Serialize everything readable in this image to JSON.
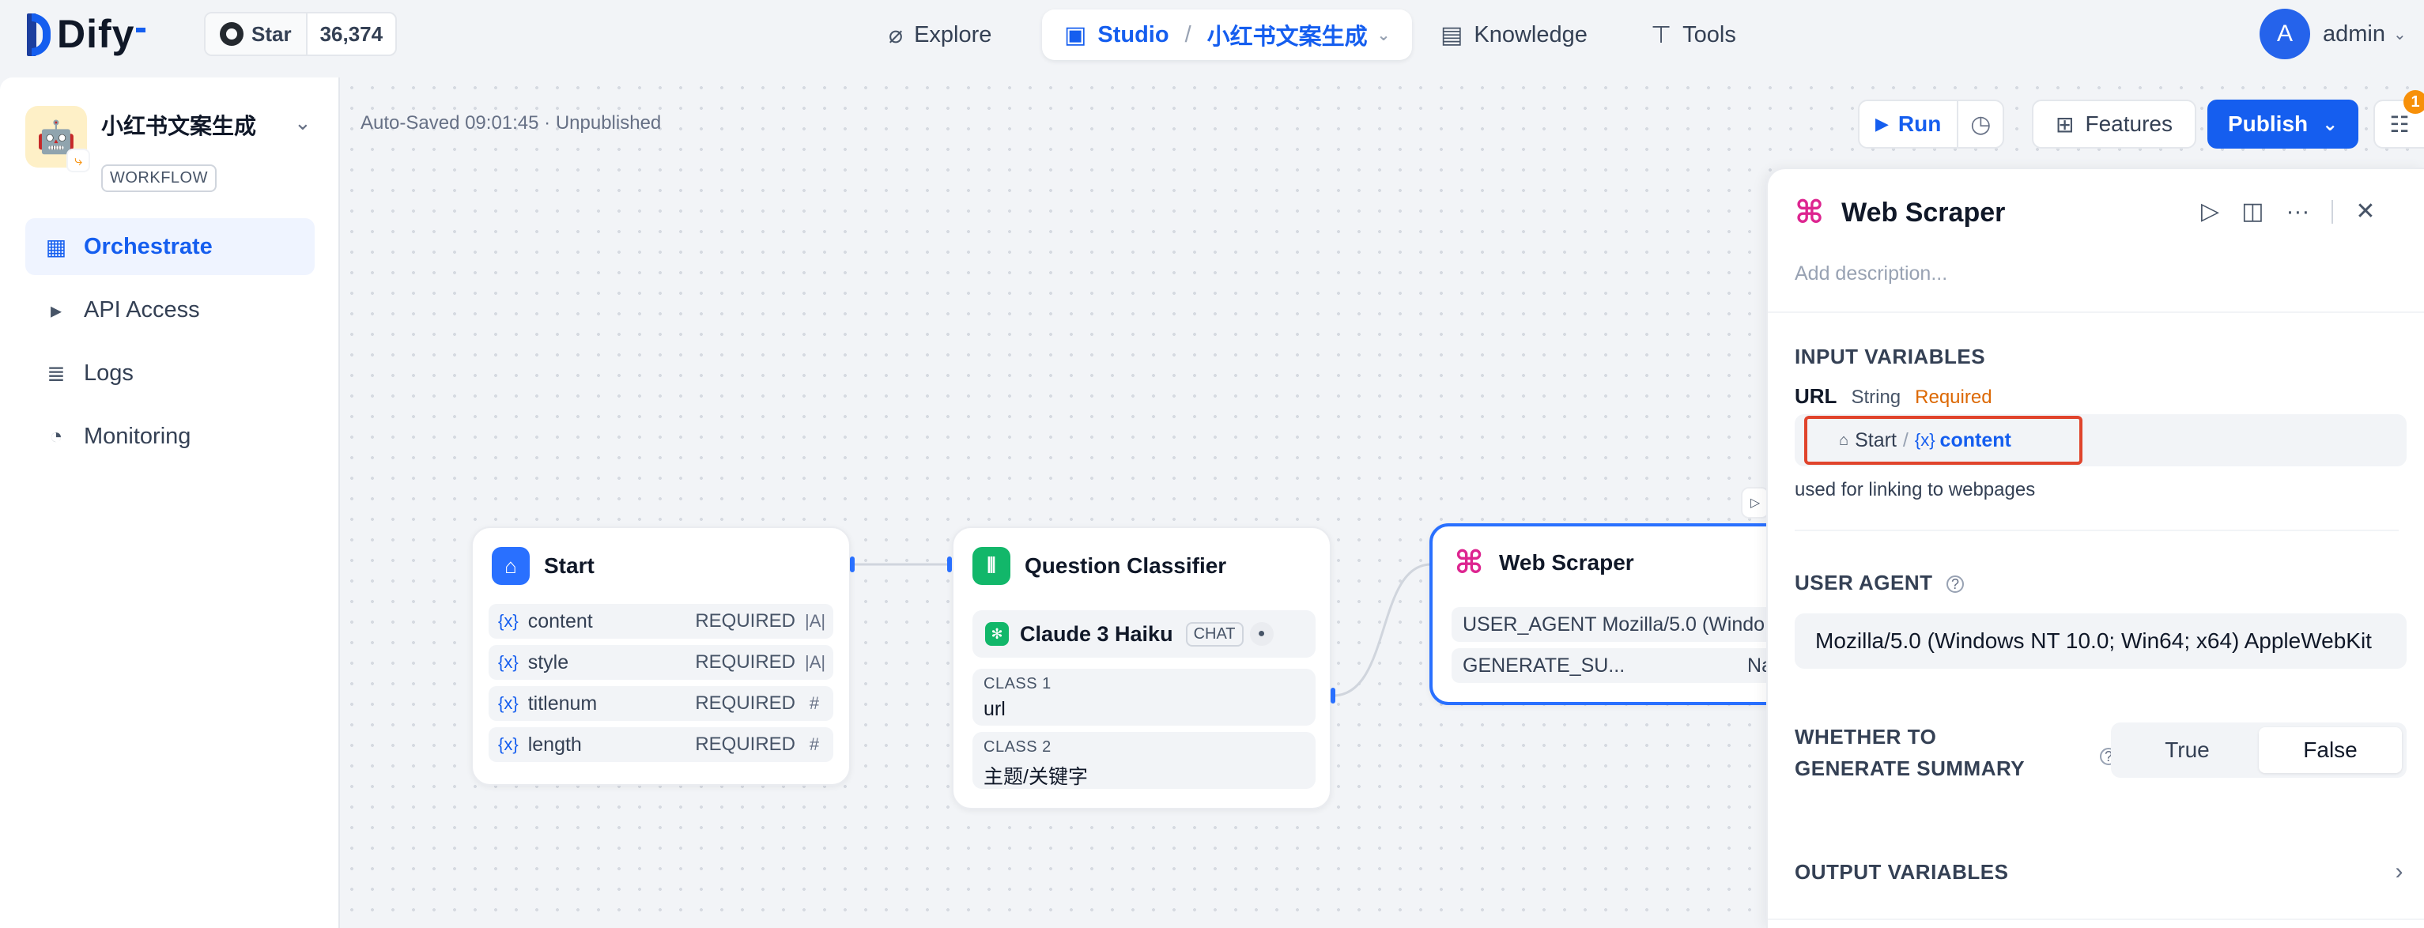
{
  "brand": {
    "name": "Dify"
  },
  "github": {
    "star_label": "Star",
    "count": "36,374"
  },
  "nav": {
    "explore": "Explore",
    "studio": "Studio",
    "app_name": "小红书文案生成",
    "knowledge": "Knowledge",
    "tools": "Tools"
  },
  "user": {
    "initial": "A",
    "name": "admin"
  },
  "sidebar": {
    "app_name": "小红书文案生成",
    "app_type": "WORKFLOW",
    "items": [
      {
        "label": "Orchestrate",
        "icon": "layout-icon",
        "active": true
      },
      {
        "label": "API Access",
        "icon": "terminal-icon",
        "active": false
      },
      {
        "label": "Logs",
        "icon": "file-list-icon",
        "active": false
      },
      {
        "label": "Monitoring",
        "icon": "gauge-icon",
        "active": false
      }
    ]
  },
  "toolbar": {
    "status": "Auto-Saved 09:01:45 · Unpublished",
    "run": "Run",
    "features": "Features",
    "publish": "Publish",
    "checklist_count": "1"
  },
  "nodes": {
    "start": {
      "title": "Start",
      "vars": [
        {
          "name": "content",
          "req": "REQUIRED",
          "type": "|A|"
        },
        {
          "name": "style",
          "req": "REQUIRED",
          "type": "|A|"
        },
        {
          "name": "titlenum",
          "req": "REQUIRED",
          "type": "#"
        },
        {
          "name": "length",
          "req": "REQUIRED",
          "type": "#"
        }
      ]
    },
    "classifier": {
      "title": "Question Classifier",
      "model": "Claude 3 Haiku",
      "mode": "CHAT",
      "classes": [
        {
          "label": "CLASS 1",
          "value": "url"
        },
        {
          "label": "CLASS 2",
          "value": "主题/关键字"
        }
      ]
    },
    "scraper": {
      "title": "Web Scraper",
      "rows": [
        {
          "key": "USER_AGENT",
          "value": "Mozilla/5.0 (Windo..."
        },
        {
          "key": "GENERATE_SU...",
          "value": "Na"
        }
      ]
    }
  },
  "panel": {
    "title": "Web Scraper",
    "description_placeholder": "Add description...",
    "input_section": "INPUT VARIABLES",
    "url_name": "URL",
    "url_type": "String",
    "url_required": "Required",
    "var_source": "Start",
    "var_name": "content",
    "url_hint": "used for linking to webpages",
    "user_agent_label": "USER AGENT",
    "user_agent_value": "Mozilla/5.0 (Windows NT 10.0; Win64; x64) AppleWebKit",
    "summary_label": "WHETHER TO GENERATE SUMMARY",
    "summary_options": [
      "True",
      "False"
    ],
    "summary_selected": "False",
    "output_section": "OUTPUT VARIABLES"
  },
  "colors": {
    "accent": "#155eef",
    "highlight": "#e0442c",
    "start_icon": "#2970ff",
    "classifier_icon": "#12b76a",
    "scraper_icon": "#dd2590"
  }
}
